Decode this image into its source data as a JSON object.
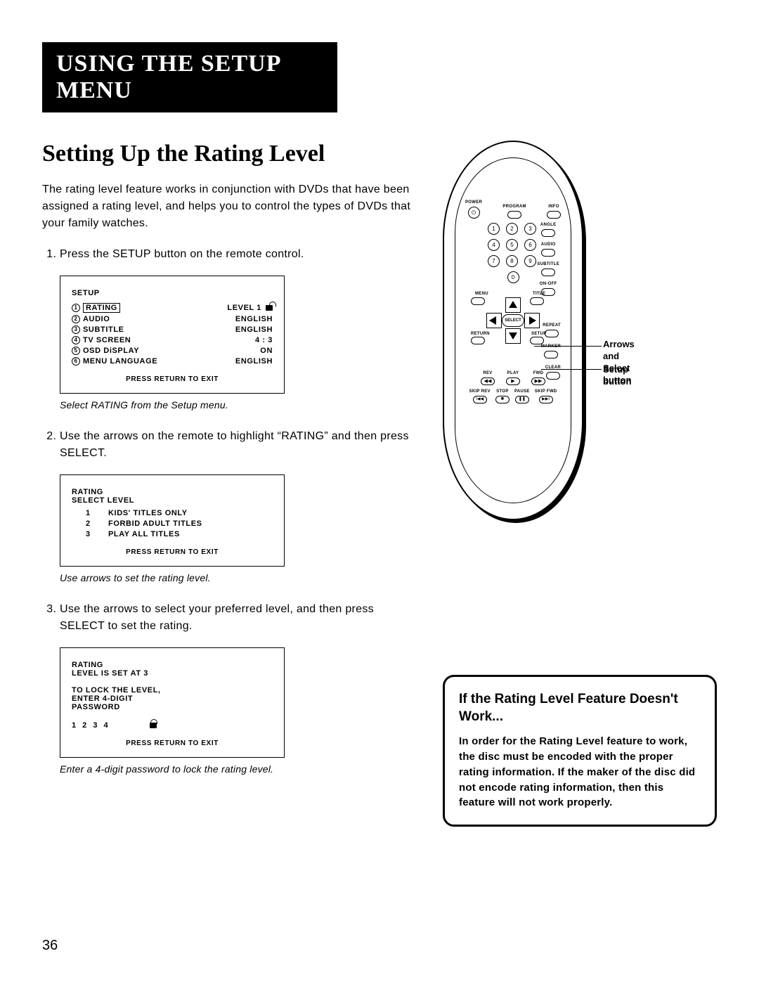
{
  "header": "USING THE SETUP MENU",
  "section_title": "Setting Up the Rating Level",
  "intro": "The rating level feature works in conjunction with DVDs that have been assigned a rating level, and helps you to control the types of DVDs that your family watches.",
  "steps": [
    "Press the SETUP button on the remote control.",
    "Use the arrows on the remote to highlight “RATING” and then press SELECT.",
    "Use the arrows to select your preferred level, and then press SELECT to set the rating."
  ],
  "screen1": {
    "title": "SETUP",
    "items": [
      {
        "n": "1",
        "label": "RATING",
        "value": "LEVEL 1",
        "lock": true,
        "boxed": true
      },
      {
        "n": "2",
        "label": "AUDIO",
        "value": "ENGLISH"
      },
      {
        "n": "3",
        "label": "SUBTITLE",
        "value": "ENGLISH"
      },
      {
        "n": "4",
        "label": "TV SCREEN",
        "value": "4 : 3"
      },
      {
        "n": "5",
        "label": "OSD DiSPLAY",
        "value": "ON"
      },
      {
        "n": "6",
        "label": "MENU LANGUAGE",
        "value": "ENGLISH"
      }
    ],
    "footer": "PRESS RETURN TO EXIT"
  },
  "caption1": "Select RATING from the Setup menu.",
  "screen2": {
    "title1": "RATING",
    "title2": "SELECT LEVEL",
    "levels": [
      {
        "n": "1",
        "label": "KIDS' TITLES ONLY"
      },
      {
        "n": "2",
        "label": "FORBID ADULT TITLES"
      },
      {
        "n": "3",
        "label": "PLAY ALL TITLES"
      }
    ],
    "footer": "PRESS RETURN TO EXIT"
  },
  "caption2": "Use arrows to set the rating level.",
  "screen3": {
    "title1": "RATING",
    "title2": "LEVEL IS SET AT 3",
    "line1": "TO LOCK THE LEVEL,",
    "line2": "ENTER 4-DIGIT",
    "line3": "PASSWORD",
    "digits": "1 2 3 4",
    "footer": "PRESS RETURN TO EXIT"
  },
  "caption3": "Enter a 4-digit password to lock the rating level.",
  "notice": {
    "title": "If the Rating Level Feature Doesn't Work...",
    "body": "In order for the Rating Level feature to work, the disc must be encoded with the proper rating information. If the maker of the disc did not encode rating information, then this feature will not work properly."
  },
  "page_number": "36",
  "remote": {
    "power": "POWER",
    "program": "PROGRAM",
    "info": "INFO",
    "angle": "ANGLE",
    "audio": "AUDIO",
    "subtitle": "SUBTITLE",
    "onoff": "ON-OFF",
    "menu": "MENU",
    "title": "TITLE",
    "repeat": "REPEAT",
    "marker": "MARKER",
    "return": "RETURN",
    "setup": "SETUP",
    "clear": "CLEAR",
    "select": "SELECT",
    "rev": "REV",
    "play": "PLAY",
    "fwd": "FWD",
    "skiprev": "SKIP REV",
    "stop": "STOP",
    "pause": "PAUSE",
    "skipfwd": "SKIP FWD",
    "nums": [
      "1",
      "2",
      "3",
      "4",
      "5",
      "6",
      "7",
      "8",
      "9"
    ],
    "zero": "0"
  },
  "callouts": {
    "arrows": "Arrows and Select button",
    "setup": "Setup button"
  }
}
